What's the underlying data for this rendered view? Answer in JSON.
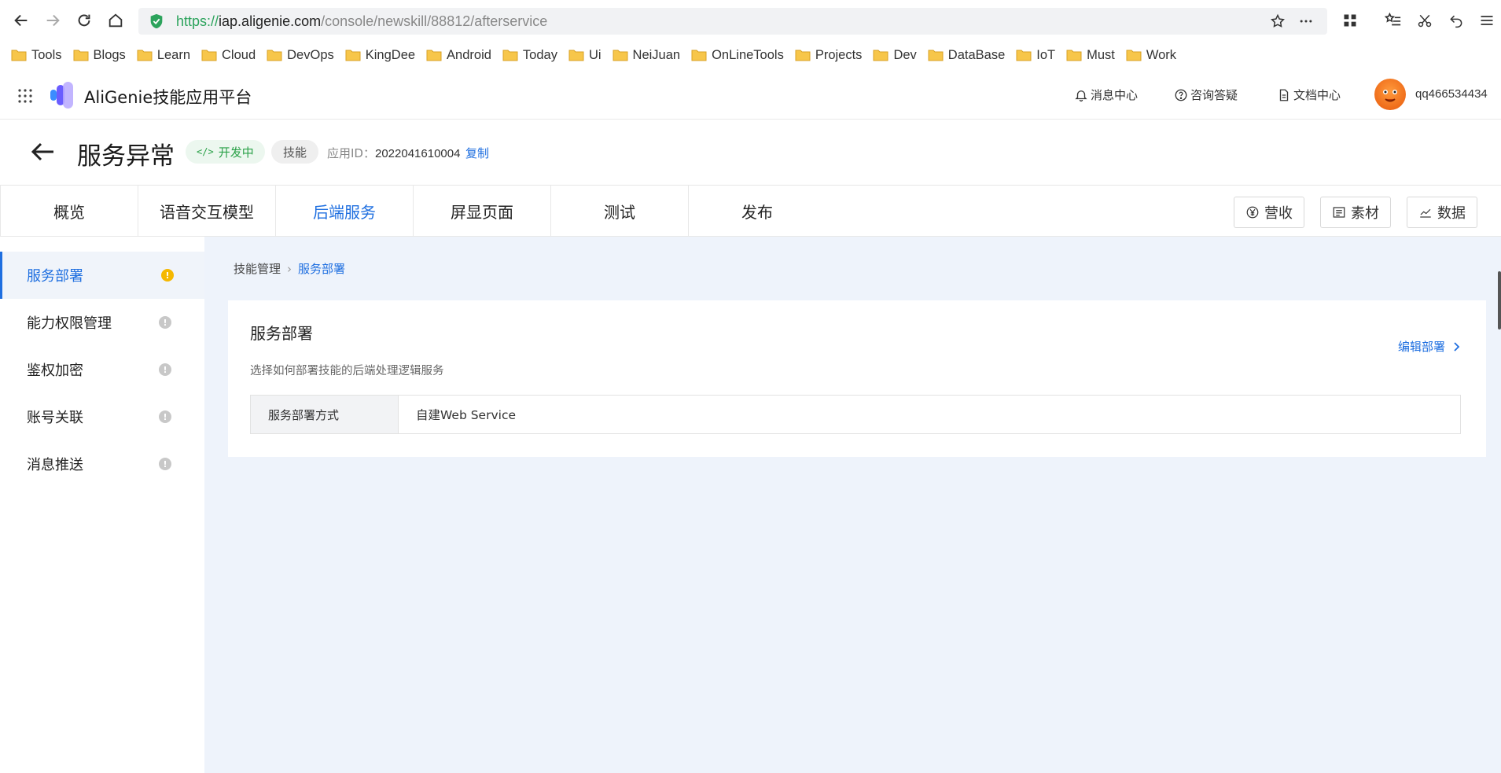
{
  "browser": {
    "url_protocol": "https://",
    "url_host": "iap.aligenie.com",
    "url_path": "/console/newskill/88812/afterservice",
    "bookmarks": [
      "Tools",
      "Blogs",
      "Learn",
      "Cloud",
      "DevOps",
      "KingDee",
      "Android",
      "Today",
      "Ui",
      "NeiJuan",
      "OnLineTools",
      "Projects",
      "Dev",
      "DataBase",
      "IoT",
      "Must",
      "Work"
    ]
  },
  "app": {
    "title": "AliGenie技能应用平台",
    "links": {
      "messages": "消息中心",
      "consult": "咨询答疑",
      "docs": "文档中心"
    },
    "username": "qq466534434"
  },
  "skill": {
    "name": "服务异常",
    "status": "开发中",
    "type": "技能",
    "app_id_label": "应用ID：",
    "app_id": "2022041610004",
    "copy_label": "复制"
  },
  "tabs": [
    {
      "label": "概览",
      "active": false
    },
    {
      "label": "语音交互模型",
      "active": false
    },
    {
      "label": "后端服务",
      "active": true
    },
    {
      "label": "屏显页面",
      "active": false
    },
    {
      "label": "测试",
      "active": false
    },
    {
      "label": "发布",
      "active": false
    }
  ],
  "tab_actions": {
    "revenue": "营收",
    "material": "素材",
    "data": "数据"
  },
  "sidebar": {
    "items": [
      {
        "label": "服务部署",
        "active": true,
        "status": "warning"
      },
      {
        "label": "能力权限管理",
        "active": false,
        "status": "info"
      },
      {
        "label": "鉴权加密",
        "active": false,
        "status": "info"
      },
      {
        "label": "账号关联",
        "active": false,
        "status": "info"
      },
      {
        "label": "消息推送",
        "active": false,
        "status": "info"
      }
    ]
  },
  "breadcrumb": {
    "parent": "技能管理",
    "current": "服务部署"
  },
  "card": {
    "title": "服务部署",
    "description": "选择如何部署技能的后端处理逻辑服务",
    "edit_label": "编辑部署",
    "rows": [
      {
        "key": "服务部署方式",
        "value": "自建Web Service"
      }
    ]
  },
  "colors": {
    "accent": "#1f6fe0",
    "status_green": "#2aa148",
    "warning": "#f5b800",
    "main_bg": "#eef3fb"
  }
}
